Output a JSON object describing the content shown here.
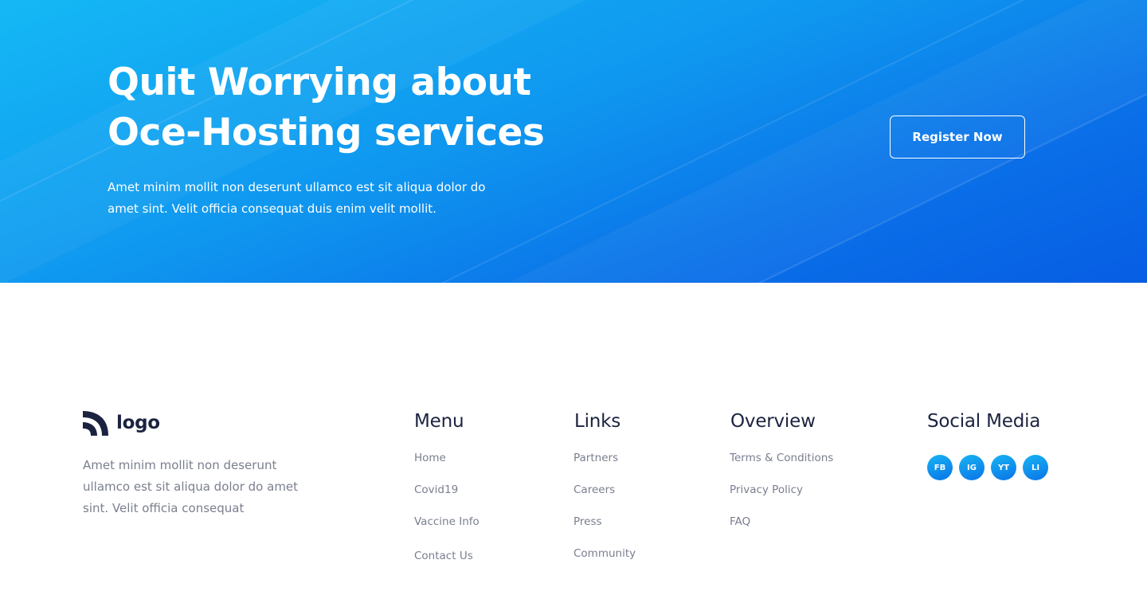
{
  "hero": {
    "title_line1": "Quit Worrying about",
    "title_line2": "Oce-Hosting services",
    "subtitle_line1": "Amet minim mollit non deserunt ullamco est sit aliqua dolor do",
    "subtitle_line2": "amet sint. Velit officia consequat duis enim velit mollit.",
    "register_label": "Register Now"
  },
  "footer": {
    "logo_text": "logo",
    "description_line1": "Amet minim mollit non deserunt",
    "description_line2": "ullamco est sit aliqua dolor do amet",
    "description_line3": "sint. Velit officia consequat",
    "menu": {
      "title": "Menu",
      "items": [
        "Home",
        "Covid19",
        "Vaccine Info",
        "Contact Us"
      ]
    },
    "links": {
      "title": "Links",
      "items": [
        "Partners",
        "Careers",
        "Press",
        "Community"
      ]
    },
    "overview": {
      "title": "Overview",
      "items": [
        "Terms & Conditions",
        "Privacy Policy",
        "FAQ"
      ]
    },
    "social": {
      "title": "Social Media",
      "items": [
        "FB",
        "IG",
        "YT",
        "LI"
      ]
    }
  },
  "colors": {
    "hero_gradient_start": "#15b9f5",
    "hero_gradient_end": "#075ee3",
    "heading_dark": "#1b2340",
    "muted_text": "#7a7f8f"
  }
}
